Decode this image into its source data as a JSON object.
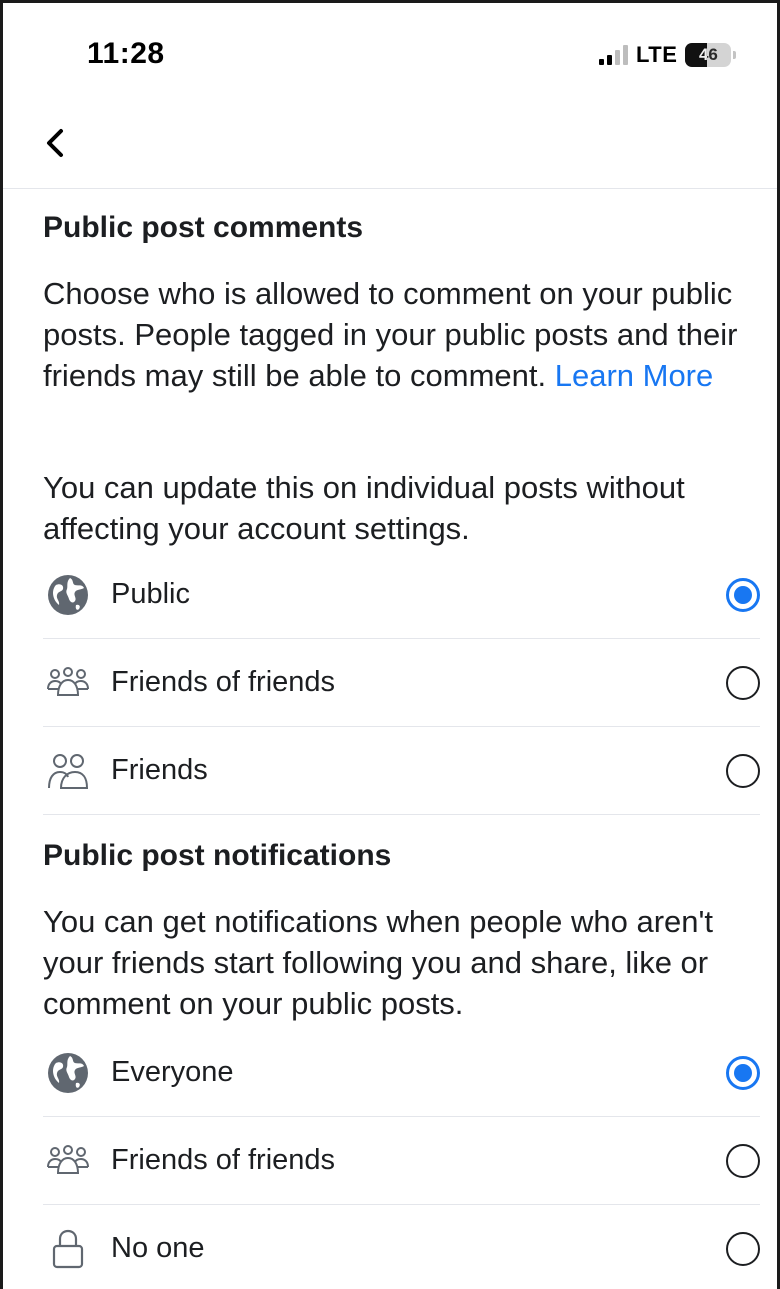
{
  "status_bar": {
    "time": "11:28",
    "network": "LTE",
    "battery_level": "46"
  },
  "nav": {
    "back_icon": "chevron-left-icon"
  },
  "comments_section": {
    "title": "Public post comments",
    "description_main": "Choose who is allowed to comment on your public posts. People tagged in your public posts and their friends may still be able to comment. ",
    "learn_more": "Learn More",
    "note": "You can update this on individual posts without affecting your account settings.",
    "options": [
      {
        "label": "Public",
        "icon": "globe-icon",
        "selected": true
      },
      {
        "label": "Friends of friends",
        "icon": "friends-of-friends-icon",
        "selected": false
      },
      {
        "label": "Friends",
        "icon": "friends-icon",
        "selected": false
      }
    ]
  },
  "notifications_section": {
    "title": "Public post notifications",
    "description": "You can get notifications when people who aren't your friends start following you and share, like or comment on your public posts.",
    "options": [
      {
        "label": "Everyone",
        "icon": "globe-icon",
        "selected": true
      },
      {
        "label": "Friends of friends",
        "icon": "friends-of-friends-icon",
        "selected": false
      },
      {
        "label": "No one",
        "icon": "lock-icon",
        "selected": false
      }
    ]
  },
  "colors": {
    "accent": "#1877f2",
    "text": "#1c1e21",
    "divider": "#e4e6eb"
  }
}
